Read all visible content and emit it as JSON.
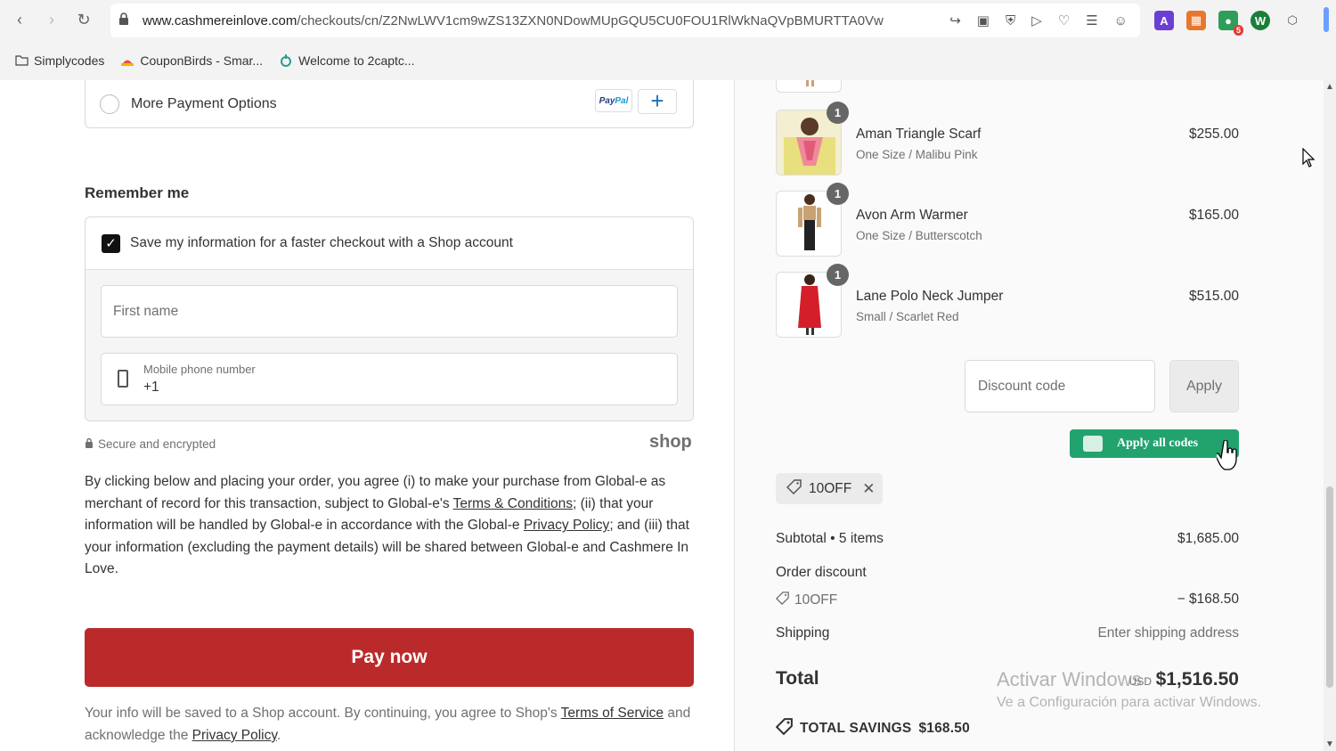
{
  "browser": {
    "url_host": "www.cashmereinlove.com",
    "url_path": "/checkouts/cn/Z2NwLWV1cm9wZS13ZXN0NDowMUpGQU5CU0FOU1RlWkNaQVpBMURTTA0Vw",
    "extension_badge": "5",
    "bookmarks": [
      {
        "label": "Simplycodes",
        "icon": "folder-icon"
      },
      {
        "label": "CouponBirds - Smar...",
        "icon": "couponbirds-icon"
      },
      {
        "label": "Welcome to 2captc...",
        "icon": "2captcha-icon"
      }
    ]
  },
  "payment": {
    "more_options_label": "More Payment Options",
    "paypal_label_a": "Pay",
    "paypal_label_b": "Pal"
  },
  "remember": {
    "heading": "Remember me",
    "checkbox_label": "Save my information for a faster checkout with a Shop account",
    "first_name_placeholder": "First name",
    "phone_label": "Mobile phone number",
    "phone_value": "+1"
  },
  "secure": {
    "label": "Secure and encrypted",
    "shop_logo": "shop"
  },
  "legal": {
    "p1": "By clicking below and placing your order, you agree (i) to make your purchase from Global-e as merchant of record for this transaction, subject to Global-e's ",
    "terms_link": "Terms & Conditions",
    "p2": "; (ii) that your information will be handled by Global-e in accordance with the Global-e ",
    "privacy_link": "Privacy Policy",
    "p3": "; and (iii) that your information (excluding the payment details) will be shared between Global-e and Cashmere In Love."
  },
  "pay_now_label": "Pay now",
  "shop_note": {
    "p1": "Your info will be saved to a Shop account. By continuing, you agree to Shop's ",
    "tos_link": "Terms of Service",
    "p2": " and acknowledge the ",
    "privacy_link": "Privacy Policy",
    "p3": "."
  },
  "cart": {
    "items": [
      {
        "name": "Aman Triangle Scarf",
        "variant": "One Size / Malibu Pink",
        "price": "$255.00",
        "qty": "1"
      },
      {
        "name": "Avon Arm Warmer",
        "variant": "One Size / Butterscotch",
        "price": "$165.00",
        "qty": "1"
      },
      {
        "name": "Lane Polo Neck Jumper",
        "variant": "Small / Scarlet Red",
        "price": "$515.00",
        "qty": "1"
      }
    ],
    "discount_placeholder": "Discount code",
    "apply_label": "Apply",
    "apply_all_label": "Apply all codes",
    "applied_code": "10OFF",
    "subtotal_label": "Subtotal • 5 items",
    "subtotal_value": "$1,685.00",
    "order_discount_label": "Order discount",
    "discount_code": "10OFF",
    "discount_value": "− $168.50",
    "shipping_label": "Shipping",
    "shipping_value": "Enter shipping address",
    "total_label": "Total",
    "currency": "USD",
    "total_value": "$1,516.50",
    "savings_label": "TOTAL SAVINGS",
    "savings_value": "$168.50"
  },
  "watermark": {
    "line1": "Activar Windows",
    "line2": "Ve a Configuración para activar Windows."
  }
}
